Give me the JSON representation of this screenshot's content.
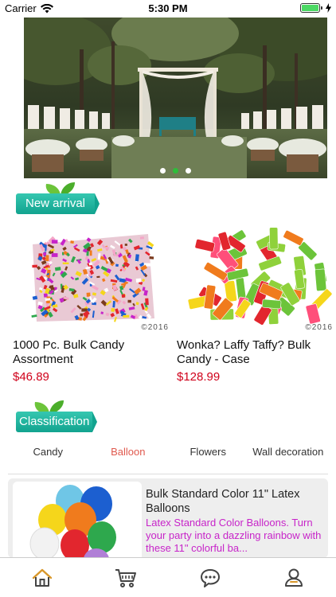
{
  "status_bar": {
    "carrier": "Carrier",
    "time": "5:30 PM",
    "battery_color": "#4cd964"
  },
  "banner": {
    "image": "outdoor wedding ceremony arch with white chairs and flowers",
    "dots": [
      {
        "active": false
      },
      {
        "active": true
      },
      {
        "active": false
      }
    ]
  },
  "sections": {
    "new_arrival_label": "New arrival",
    "classification_label": "Classification"
  },
  "products": [
    {
      "name": "1000 Pc. Bulk Candy Assortment",
      "price": "$46.89",
      "copyright": "©2016"
    },
    {
      "name": "Wonka? Laffy Taffy? Bulk Candy - Case",
      "price": "$128.99",
      "copyright": "©2016"
    }
  ],
  "classification_tabs": [
    {
      "label": "Candy",
      "active": false
    },
    {
      "label": "Balloon",
      "active": true
    },
    {
      "label": "Flowers",
      "active": false
    },
    {
      "label": "Wall decoration",
      "active": false
    }
  ],
  "item": {
    "title": "Bulk Standard Color 11\" Latex Balloons",
    "description": "Latex Standard Color Balloons. Turn your party into a dazzling rainbow with these 11\" colorful ba..."
  },
  "tabbar": [
    {
      "icon": "home-icon"
    },
    {
      "icon": "cart-icon"
    },
    {
      "icon": "chat-icon"
    },
    {
      "icon": "profile-icon"
    }
  ],
  "colors": {
    "price": "#d0021b",
    "active_tab": "#e0594e",
    "description": "#c724c9",
    "tag": "#12a38f",
    "active_dot": "#2ebd3a"
  }
}
